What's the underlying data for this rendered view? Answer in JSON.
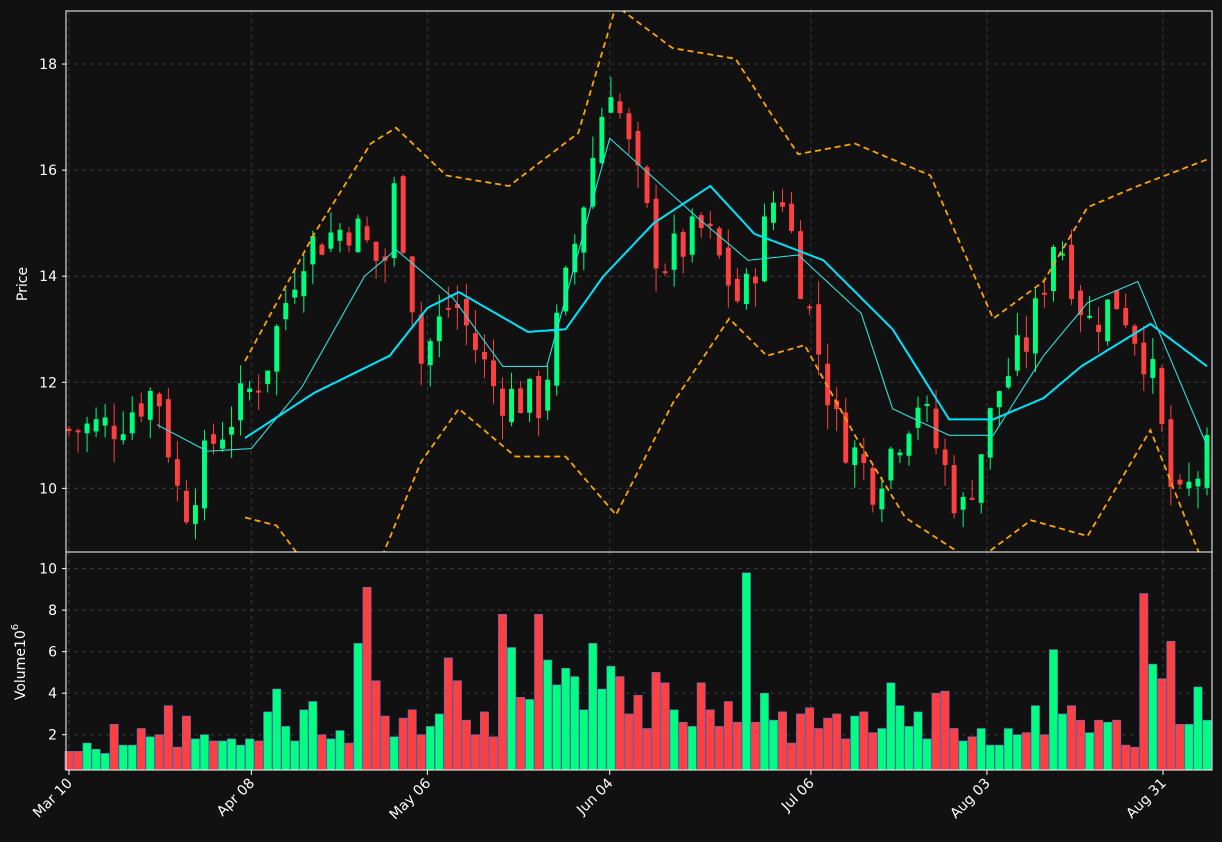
{
  "colors": {
    "background": "#111111",
    "frame": "#ffffff",
    "grid": "#3a3a3a",
    "up": "#00ff7f",
    "down": "#ff4040",
    "sma_fast": "#33dddd",
    "sma_slow": "#00e5ff",
    "bollinger": "#ffa500",
    "text": "#ffffff"
  },
  "chart_data": [
    {
      "type": "candlestick",
      "ylabel": "Price",
      "ylim": [
        8.8,
        19.0
      ],
      "yticks": [
        "10",
        "12",
        "14",
        "16",
        "18"
      ],
      "x": {
        "start": "2024-03-10",
        "end": "2024-09-07",
        "tick_labels": [
          "Mar 10",
          "Apr 08",
          "May 06",
          "Jun 04",
          "Jul 06",
          "Aug 03",
          "Aug 31"
        ]
      },
      "grid": true,
      "overlays": [
        "SMA short (thin cyan)",
        "SMA long (thick cyan)",
        "Bollinger Bands (dashed orange)"
      ],
      "ohlc_anchor_closes": [
        [
          "2024-03-10",
          11.1
        ],
        [
          "2024-03-17",
          11.2
        ],
        [
          "2024-03-24",
          11.9
        ],
        [
          "2024-03-28",
          9.5
        ],
        [
          "2024-04-02",
          10.9
        ],
        [
          "2024-04-10",
          12.2
        ],
        [
          "2024-04-16",
          14.5
        ],
        [
          "2024-04-24",
          15.0
        ],
        [
          "2024-04-29",
          14.1
        ],
        [
          "2024-05-01",
          15.8
        ],
        [
          "2024-05-05",
          12.4
        ],
        [
          "2024-05-10",
          13.6
        ],
        [
          "2024-05-17",
          11.8
        ],
        [
          "2024-05-24",
          11.6
        ],
        [
          "2024-05-28",
          13.8
        ],
        [
          "2024-06-04",
          17.8
        ],
        [
          "2024-06-07",
          16.4
        ],
        [
          "2024-06-12",
          14.2
        ],
        [
          "2024-06-19",
          14.9
        ],
        [
          "2024-06-25",
          13.4
        ],
        [
          "2024-07-01",
          15.8
        ],
        [
          "2024-07-04",
          14.2
        ],
        [
          "2024-07-10",
          11.2
        ],
        [
          "2024-07-16",
          10.1
        ],
        [
          "2024-07-23",
          11.7
        ],
        [
          "2024-07-30",
          9.5
        ],
        [
          "2024-08-05",
          11.9
        ],
        [
          "2024-08-10",
          12.9
        ],
        [
          "2024-08-14",
          14.9
        ],
        [
          "2024-08-19",
          13.1
        ],
        [
          "2024-08-24",
          13.6
        ],
        [
          "2024-08-29",
          12.3
        ],
        [
          "2024-09-02",
          9.5
        ],
        [
          "2024-09-07",
          10.6
        ]
      ],
      "sma_short_anchor": [
        [
          "2024-03-24",
          11.2
        ],
        [
          "2024-04-01",
          10.7
        ],
        [
          "2024-04-08",
          10.75
        ],
        [
          "2024-04-16",
          11.9
        ],
        [
          "2024-04-26",
          14.0
        ],
        [
          "2024-05-01",
          14.5
        ],
        [
          "2024-05-10",
          13.6
        ],
        [
          "2024-05-18",
          12.3
        ],
        [
          "2024-05-25",
          12.3
        ],
        [
          "2024-06-04",
          16.6
        ],
        [
          "2024-06-18",
          15.1
        ],
        [
          "2024-06-26",
          14.3
        ],
        [
          "2024-07-04",
          14.4
        ],
        [
          "2024-07-14",
          13.3
        ],
        [
          "2024-07-19",
          11.5
        ],
        [
          "2024-07-28",
          11.0
        ],
        [
          "2024-08-04",
          11.0
        ],
        [
          "2024-08-12",
          12.5
        ],
        [
          "2024-08-19",
          13.5
        ],
        [
          "2024-08-27",
          13.9
        ],
        [
          "2024-09-07",
          10.8
        ]
      ],
      "sma_long_anchor": [
        [
          "2024-04-07",
          10.95
        ],
        [
          "2024-04-18",
          11.8
        ],
        [
          "2024-04-30",
          12.5
        ],
        [
          "2024-05-06",
          13.4
        ],
        [
          "2024-05-11",
          13.7
        ],
        [
          "2024-05-22",
          12.95
        ],
        [
          "2024-05-28",
          13.0
        ],
        [
          "2024-06-03",
          14.0
        ],
        [
          "2024-06-11",
          15.0
        ],
        [
          "2024-06-20",
          15.7
        ],
        [
          "2024-06-27",
          14.8
        ],
        [
          "2024-07-08",
          14.3
        ],
        [
          "2024-07-19",
          13.0
        ],
        [
          "2024-07-28",
          11.3
        ],
        [
          "2024-08-04",
          11.3
        ],
        [
          "2024-08-12",
          11.7
        ],
        [
          "2024-08-18",
          12.3
        ],
        [
          "2024-08-29",
          13.1
        ],
        [
          "2024-09-07",
          12.3
        ]
      ],
      "bollinger_upper_anchor": [
        [
          "2024-04-07",
          12.4
        ],
        [
          "2024-04-18",
          14.8
        ],
        [
          "2024-04-27",
          16.5
        ],
        [
          "2024-05-01",
          16.8
        ],
        [
          "2024-05-09",
          15.9
        ],
        [
          "2024-05-19",
          15.7
        ],
        [
          "2024-05-30",
          16.7
        ],
        [
          "2024-06-05",
          19.1
        ],
        [
          "2024-06-14",
          18.3
        ],
        [
          "2024-06-24",
          18.1
        ],
        [
          "2024-06-30",
          17.0
        ],
        [
          "2024-07-04",
          16.3
        ],
        [
          "2024-07-13",
          16.5
        ],
        [
          "2024-07-25",
          15.9
        ],
        [
          "2024-08-04",
          13.2
        ],
        [
          "2024-08-12",
          13.9
        ],
        [
          "2024-08-19",
          15.3
        ],
        [
          "2024-08-27",
          15.7
        ],
        [
          "2024-09-07",
          16.2
        ]
      ],
      "bollinger_lower_anchor": [
        [
          "2024-04-07",
          9.45
        ],
        [
          "2024-04-12",
          9.3
        ],
        [
          "2024-04-17",
          8.5
        ],
        [
          "2024-04-27",
          8.2
        ],
        [
          "2024-05-05",
          10.5
        ],
        [
          "2024-05-11",
          11.5
        ],
        [
          "2024-05-20",
          10.6
        ],
        [
          "2024-05-28",
          10.6
        ],
        [
          "2024-06-05",
          9.5
        ],
        [
          "2024-06-14",
          11.6
        ],
        [
          "2024-06-23",
          13.2
        ],
        [
          "2024-06-29",
          12.5
        ],
        [
          "2024-07-05",
          12.7
        ],
        [
          "2024-07-13",
          11.0
        ],
        [
          "2024-07-21",
          9.45
        ],
        [
          "2024-08-01",
          8.6
        ],
        [
          "2024-08-10",
          9.4
        ],
        [
          "2024-08-19",
          9.1
        ],
        [
          "2024-08-29",
          11.1
        ],
        [
          "2024-09-07",
          8.4
        ]
      ]
    },
    {
      "type": "bar",
      "ylabel": "Volume",
      "ylabel_exponent": "10",
      "ylabel_exponent_power": "6",
      "ylim": [
        0.3,
        10.8
      ],
      "yticks": [
        "2",
        "4",
        "6",
        "8",
        "10"
      ],
      "grid": true,
      "values": [
        1.2,
        1.2,
        1.6,
        1.3,
        1.1,
        2.5,
        1.5,
        1.5,
        2.3,
        1.9,
        2.0,
        3.4,
        1.4,
        2.9,
        1.8,
        2.0,
        1.7,
        1.7,
        1.8,
        1.5,
        1.8,
        1.7,
        3.1,
        4.2,
        2.4,
        1.7,
        3.2,
        3.6,
        2.0,
        1.8,
        2.2,
        1.6,
        6.4,
        9.1,
        4.6,
        2.9,
        1.9,
        2.8,
        3.2,
        2.0,
        2.4,
        3.0,
        5.7,
        4.6,
        2.7,
        2.0,
        3.1,
        1.9,
        7.8,
        6.2,
        3.8,
        3.7,
        7.8,
        5.6,
        4.4,
        5.2,
        4.8,
        3.2,
        6.4,
        4.2,
        5.3,
        4.8,
        3.0,
        3.9,
        2.3,
        5.0,
        4.5,
        3.2,
        2.6,
        2.4,
        4.5,
        3.2,
        2.4,
        3.6,
        2.6,
        9.8,
        2.6,
        4.0,
        2.7,
        3.1,
        1.6,
        3.0,
        3.3,
        2.3,
        2.8,
        3.0,
        1.8,
        2.9,
        3.1,
        2.1,
        2.3,
        4.5,
        3.4,
        2.4,
        3.1,
        1.8,
        4.0,
        4.1,
        2.3,
        1.7,
        1.9,
        2.3,
        1.5,
        1.5,
        2.3,
        2.0,
        2.1,
        3.4,
        2.0,
        6.1,
        3.0,
        3.4,
        2.7,
        2.1,
        2.7,
        2.6,
        2.7,
        1.5,
        1.4,
        8.8,
        5.4,
        4.7,
        6.5,
        2.5,
        2.5,
        4.3,
        2.7
      ],
      "up_down": "colored to match the corresponding candle"
    }
  ]
}
